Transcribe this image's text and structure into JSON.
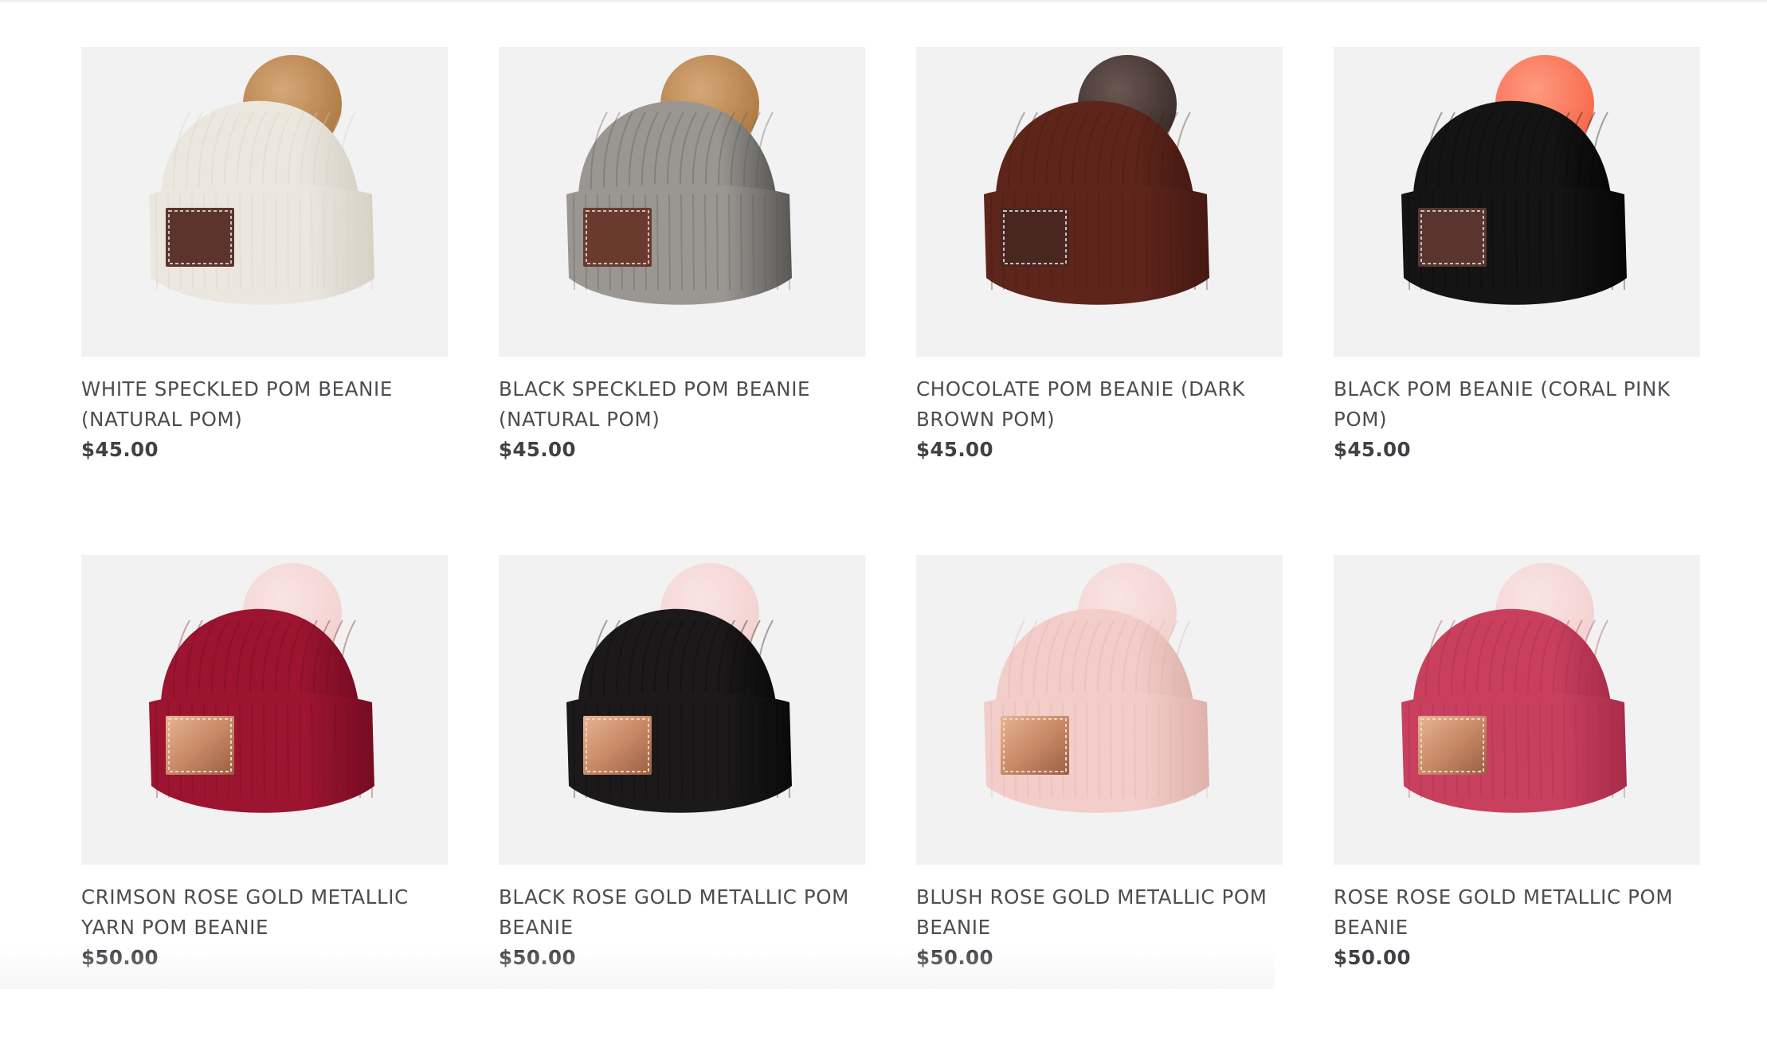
{
  "products": [
    {
      "title": "WHITE SPECKLED POM BEANIE (NATURAL POM)",
      "price": "$45.00",
      "icon": "white-beanie-natural-pom-image",
      "knit": "#ebe7df",
      "knit_dark": "#d7d1c6",
      "pom": "#b07b45",
      "pom_light": "#d5a877",
      "patch": "#5d342c",
      "patch_style": "leather"
    },
    {
      "title": "BLACK SPECKLED POM BEANIE (NATURAL POM)",
      "price": "$45.00",
      "icon": "black-speckled-beanie-natural-pom-image",
      "knit": "#9a9793",
      "knit_dark": "#5a5855",
      "pom": "#b07b45",
      "pom_light": "#d5a877",
      "patch": "#6b3a2f",
      "patch_style": "leather"
    },
    {
      "title": "CHOCOLATE POM BEANIE (DARK BROWN POM)",
      "price": "$45.00",
      "icon": "chocolate-beanie-dark-brown-pom-image",
      "knit": "#5e251b",
      "knit_dark": "#451912",
      "pom": "#3c2e2b",
      "pom_light": "#6b5752",
      "patch": "#4a2620",
      "patch_style": "leather"
    },
    {
      "title": "BLACK POM BEANIE (CORAL PINK POM)",
      "price": "$45.00",
      "icon": "black-beanie-coral-pink-pom-image",
      "knit": "#141414",
      "knit_dark": "#060606",
      "pom": "#f86a4c",
      "pom_light": "#ff9a80",
      "patch": "#5a3530",
      "patch_style": "leather"
    },
    {
      "title": "CRIMSON ROSE GOLD METALLIC YARN POM BEANIE",
      "price": "$50.00",
      "icon": "crimson-rose-gold-beanie-image",
      "knit": "#9c1430",
      "knit_dark": "#760c22",
      "pom": "#f4c8c6",
      "pom_light": "#fbe0de",
      "patch": "#c88a68",
      "patch_style": "metal"
    },
    {
      "title": "BLACK ROSE GOLD METALLIC POM BEANIE",
      "price": "$50.00",
      "icon": "black-rose-gold-beanie-image",
      "knit": "#1b1919",
      "knit_dark": "#0b0a0a",
      "pom": "#f4c8c6",
      "pom_light": "#fbe0de",
      "patch": "#c88a68",
      "patch_style": "metal"
    },
    {
      "title": "BLUSH ROSE GOLD METALLIC POM BEANIE",
      "price": "$50.00",
      "icon": "blush-rose-gold-beanie-image",
      "knit": "#f2cdc9",
      "knit_dark": "#dfb1ac",
      "pom": "#f4c8c6",
      "pom_light": "#fbe0de",
      "patch": "#c88a68",
      "patch_style": "metal"
    },
    {
      "title": "ROSE ROSE GOLD METALLIC POM BEANIE",
      "price": "$50.00",
      "icon": "rose-rose-gold-beanie-image",
      "knit": "#c9405f",
      "knit_dark": "#a82c49",
      "pom": "#f4c8c6",
      "pom_light": "#fbe0de",
      "patch": "#c88a68",
      "patch_style": "metal"
    }
  ]
}
